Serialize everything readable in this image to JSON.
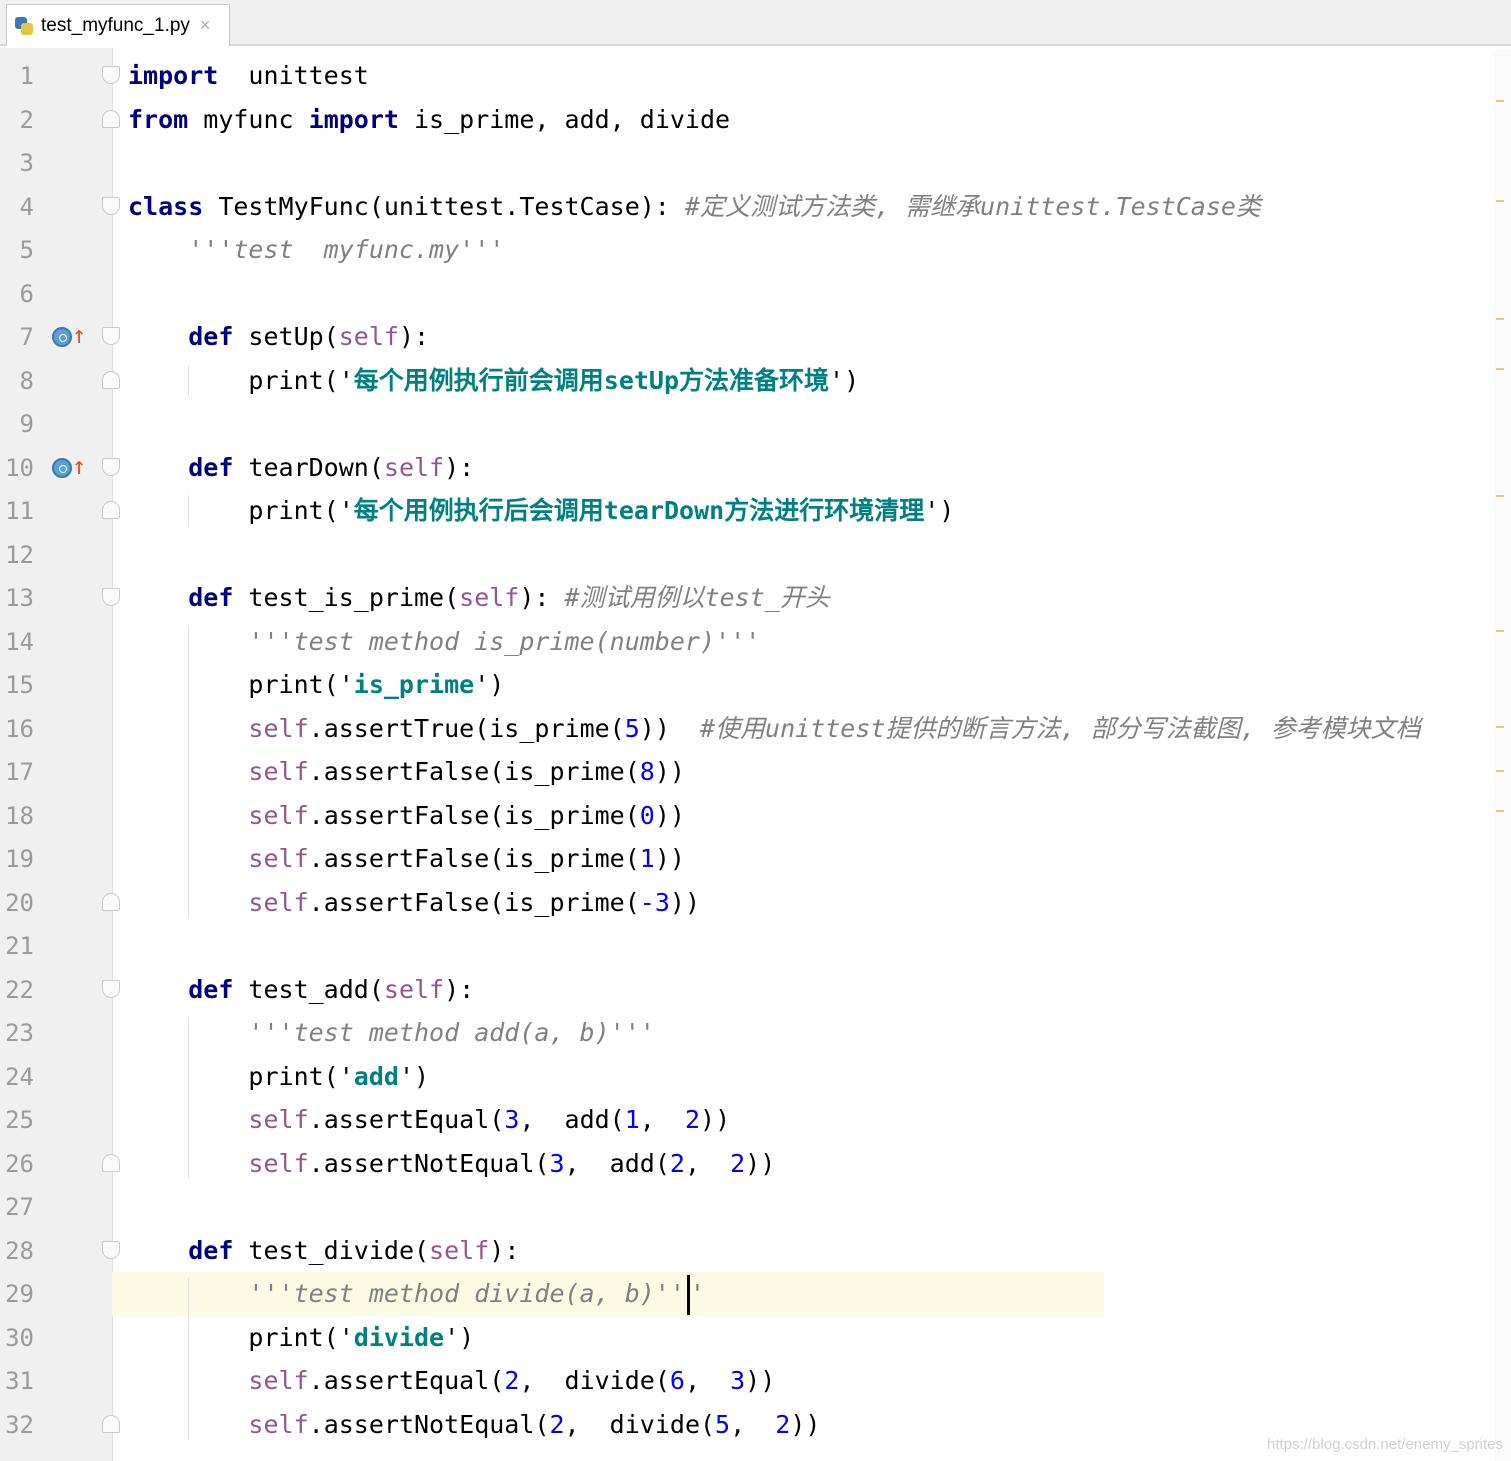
{
  "tab": {
    "filename": "test_myfunc_1.py",
    "close": "×"
  },
  "lines": [
    {
      "n": "1",
      "fold": "start",
      "tokens": [
        {
          "c": "kw",
          "t": "import"
        },
        {
          "t": "  unittest"
        }
      ]
    },
    {
      "n": "2",
      "fold": "end",
      "tokens": [
        {
          "c": "kw",
          "t": "from"
        },
        {
          "t": " myfunc "
        },
        {
          "c": "kw",
          "t": "import"
        },
        {
          "t": " is_prime, add, divide"
        }
      ]
    },
    {
      "n": "3",
      "tokens": []
    },
    {
      "n": "4",
      "fold": "start",
      "tokens": [
        {
          "c": "kw",
          "t": "class"
        },
        {
          "t": " TestMyFunc(unittest.TestCase): "
        },
        {
          "c": "cmt",
          "t": "#定义测试方法类, 需继承unittest.TestCase类"
        }
      ]
    },
    {
      "n": "5",
      "tokens": [
        {
          "t": "    "
        },
        {
          "c": "doc",
          "t": "'''test  myfunc.my'''"
        }
      ]
    },
    {
      "n": "6",
      "tokens": []
    },
    {
      "n": "7",
      "fold": "start",
      "marker": true,
      "tokens": [
        {
          "t": "    "
        },
        {
          "c": "kw",
          "t": "def"
        },
        {
          "t": " setUp("
        },
        {
          "c": "self",
          "t": "self"
        },
        {
          "t": "):"
        }
      ]
    },
    {
      "n": "8",
      "fold": "end",
      "tokens": [
        {
          "t": "        print('"
        },
        {
          "c": "str",
          "t": "每个用例执行前会调用setUp方法准备环境"
        },
        {
          "t": "')"
        }
      ]
    },
    {
      "n": "9",
      "tokens": []
    },
    {
      "n": "10",
      "fold": "start",
      "marker": true,
      "tokens": [
        {
          "t": "    "
        },
        {
          "c": "kw",
          "t": "def"
        },
        {
          "t": " tearDown("
        },
        {
          "c": "self",
          "t": "self"
        },
        {
          "t": "):"
        }
      ]
    },
    {
      "n": "11",
      "fold": "end",
      "tokens": [
        {
          "t": "        print('"
        },
        {
          "c": "str",
          "t": "每个用例执行后会调用tearDown方法进行环境清理"
        },
        {
          "t": "')"
        }
      ]
    },
    {
      "n": "12",
      "tokens": []
    },
    {
      "n": "13",
      "fold": "start",
      "tokens": [
        {
          "t": "    "
        },
        {
          "c": "kw",
          "t": "def"
        },
        {
          "t": " test_is_prime("
        },
        {
          "c": "self",
          "t": "self"
        },
        {
          "t": "): "
        },
        {
          "c": "cmt",
          "t": "#测试用例以test_开头"
        }
      ]
    },
    {
      "n": "14",
      "tokens": [
        {
          "t": "        "
        },
        {
          "c": "doc",
          "t": "'''test method is_prime(number)'''"
        }
      ]
    },
    {
      "n": "15",
      "tokens": [
        {
          "t": "        print('"
        },
        {
          "c": "str",
          "t": "is_prime"
        },
        {
          "t": "')"
        }
      ]
    },
    {
      "n": "16",
      "tokens": [
        {
          "t": "        "
        },
        {
          "c": "self",
          "t": "self"
        },
        {
          "t": ".assertTrue(is_prime("
        },
        {
          "c": "num",
          "t": "5"
        },
        {
          "t": "))  "
        },
        {
          "c": "cmt",
          "t": "#使用unittest提供的断言方法, 部分写法截图, 参考模块文档"
        }
      ]
    },
    {
      "n": "17",
      "tokens": [
        {
          "t": "        "
        },
        {
          "c": "self",
          "t": "self"
        },
        {
          "t": ".assertFalse(is_prime("
        },
        {
          "c": "num",
          "t": "8"
        },
        {
          "t": "))"
        }
      ]
    },
    {
      "n": "18",
      "tokens": [
        {
          "t": "        "
        },
        {
          "c": "self",
          "t": "self"
        },
        {
          "t": ".assertFalse(is_prime("
        },
        {
          "c": "num",
          "t": "0"
        },
        {
          "t": "))"
        }
      ]
    },
    {
      "n": "19",
      "tokens": [
        {
          "t": "        "
        },
        {
          "c": "self",
          "t": "self"
        },
        {
          "t": ".assertFalse(is_prime("
        },
        {
          "c": "num",
          "t": "1"
        },
        {
          "t": "))"
        }
      ]
    },
    {
      "n": "20",
      "fold": "end",
      "tokens": [
        {
          "t": "        "
        },
        {
          "c": "self",
          "t": "self"
        },
        {
          "t": ".assertFalse(is_prime("
        },
        {
          "c": "num",
          "t": "-3"
        },
        {
          "t": "))"
        }
      ]
    },
    {
      "n": "21",
      "tokens": []
    },
    {
      "n": "22",
      "fold": "start",
      "tokens": [
        {
          "t": "    "
        },
        {
          "c": "kw",
          "t": "def"
        },
        {
          "t": " test_add("
        },
        {
          "c": "self",
          "t": "self"
        },
        {
          "t": "):"
        }
      ]
    },
    {
      "n": "23",
      "tokens": [
        {
          "t": "        "
        },
        {
          "c": "doc",
          "t": "'''test method add(a, b)'''"
        }
      ]
    },
    {
      "n": "24",
      "tokens": [
        {
          "t": "        print('"
        },
        {
          "c": "str",
          "t": "add"
        },
        {
          "t": "')"
        }
      ]
    },
    {
      "n": "25",
      "tokens": [
        {
          "t": "        "
        },
        {
          "c": "self",
          "t": "self"
        },
        {
          "t": ".assertEqual("
        },
        {
          "c": "num",
          "t": "3"
        },
        {
          "t": ",  add("
        },
        {
          "c": "num",
          "t": "1"
        },
        {
          "t": ",  "
        },
        {
          "c": "num",
          "t": "2"
        },
        {
          "t": "))"
        }
      ]
    },
    {
      "n": "26",
      "fold": "end",
      "tokens": [
        {
          "t": "        "
        },
        {
          "c": "self",
          "t": "self"
        },
        {
          "t": ".assertNotEqual("
        },
        {
          "c": "num",
          "t": "3"
        },
        {
          "t": ",  add("
        },
        {
          "c": "num",
          "t": "2"
        },
        {
          "t": ",  "
        },
        {
          "c": "num",
          "t": "2"
        },
        {
          "t": "))"
        }
      ]
    },
    {
      "n": "27",
      "tokens": []
    },
    {
      "n": "28",
      "fold": "start",
      "tokens": [
        {
          "t": "    "
        },
        {
          "c": "kw",
          "t": "def"
        },
        {
          "t": " test_divide("
        },
        {
          "c": "self",
          "t": "self"
        },
        {
          "t": "):"
        }
      ]
    },
    {
      "n": "29",
      "current": true,
      "caret": true,
      "tokens": [
        {
          "t": "        "
        },
        {
          "c": "doc",
          "t": "'''test method divide(a, b)''"
        },
        {
          "caret": true
        },
        {
          "c": "doc",
          "t": "'"
        }
      ]
    },
    {
      "n": "30",
      "tokens": [
        {
          "t": "        print('"
        },
        {
          "c": "str",
          "t": "divide"
        },
        {
          "t": "')"
        }
      ]
    },
    {
      "n": "31",
      "tokens": [
        {
          "t": "        "
        },
        {
          "c": "self",
          "t": "self"
        },
        {
          "t": ".assertEqual("
        },
        {
          "c": "num",
          "t": "2"
        },
        {
          "t": ",  divide("
        },
        {
          "c": "num",
          "t": "6"
        },
        {
          "t": ",  "
        },
        {
          "c": "num",
          "t": "3"
        },
        {
          "t": "))"
        }
      ]
    },
    {
      "n": "32",
      "fold": "end",
      "tokens": [
        {
          "t": "        "
        },
        {
          "c": "self",
          "t": "self"
        },
        {
          "t": ".assertNotEqual("
        },
        {
          "c": "num",
          "t": "2"
        },
        {
          "t": ",  divide("
        },
        {
          "c": "num",
          "t": "5"
        },
        {
          "t": ",  "
        },
        {
          "c": "num",
          "t": "2"
        },
        {
          "t": "))"
        }
      ]
    }
  ],
  "watermark": "https://blog.csdn.net/enemy_sprites",
  "colors": {
    "keyword": "#000080",
    "self": "#94558d",
    "string": "#008080",
    "comment": "#808080",
    "number": "#0000ff",
    "current_line": "#fcfae2"
  }
}
